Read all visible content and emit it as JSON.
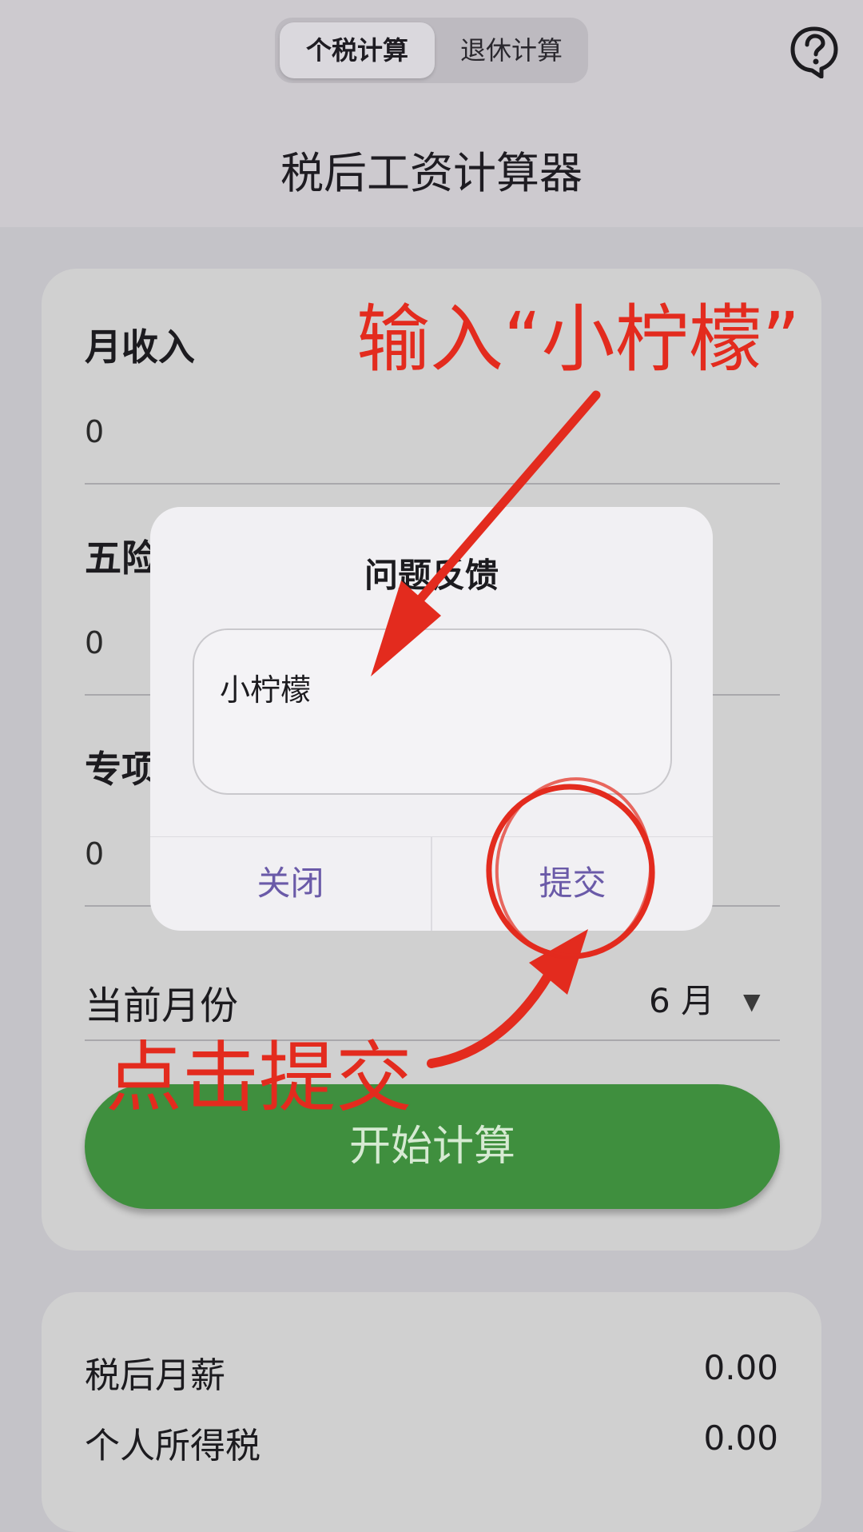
{
  "header": {
    "tabs": [
      {
        "label": "个税计算",
        "active": true
      },
      {
        "label": "退休计算",
        "active": false
      }
    ],
    "help_icon": "help-bubble-icon",
    "title": "税后工资计算器"
  },
  "form": {
    "monthly_income": {
      "label": "月收入",
      "value": "0"
    },
    "insurance": {
      "label": "五险",
      "value": "0"
    },
    "special_deduction": {
      "label": "专项",
      "value": "0"
    },
    "current_month": {
      "label": "当前月份",
      "value": "6 月",
      "arrow_icon": "dropdown-arrow-icon"
    },
    "calculate_button": "开始计算"
  },
  "results": {
    "after_tax_salary": {
      "label": "税后月薪",
      "value": "0.00"
    },
    "income_tax": {
      "label": "个人所得税",
      "value": "0.00"
    }
  },
  "dialog": {
    "title": "问题反馈",
    "input_value": "小柠檬",
    "close_label": "关闭",
    "submit_label": "提交"
  },
  "annotations": {
    "input_hint": "输入“小柠檬”",
    "submit_hint": "点击提交",
    "color": "#e32b1e"
  },
  "colors": {
    "accent_green": "#3f8f3e",
    "dialog_button": "#6a5aa8"
  }
}
